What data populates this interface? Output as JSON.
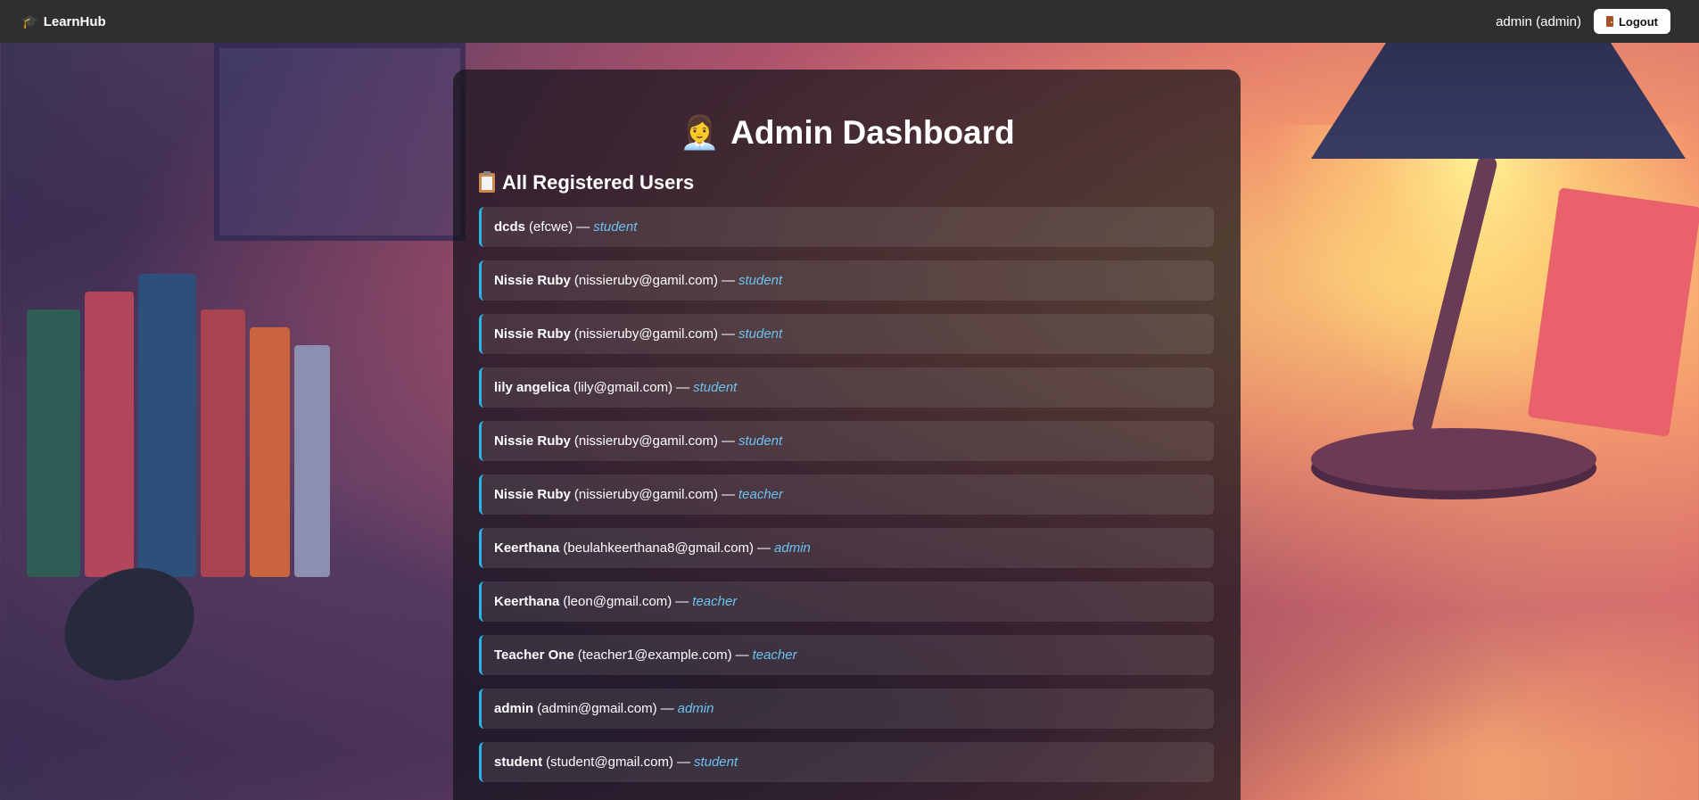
{
  "navbar": {
    "brand": "LearnHub",
    "brand_icon": "graduation-cap-icon",
    "user_label": "admin (admin)",
    "logout_label": "Logout",
    "logout_icon": "door-icon"
  },
  "main": {
    "title": "Admin Dashboard",
    "title_emoji": "👩‍💼",
    "section_title": "All Registered Users",
    "section_icon": "clipboard-icon",
    "separator": "—",
    "users": [
      {
        "name": "dcds",
        "email": "(efcwe)",
        "role": "student"
      },
      {
        "name": "Nissie Ruby",
        "email": "(nissieruby@gamil.com)",
        "role": "student"
      },
      {
        "name": "Nissie Ruby",
        "email": "(nissieruby@gamil.com)",
        "role": "student"
      },
      {
        "name": "lily angelica",
        "email": "(lily@gmail.com)",
        "role": "student"
      },
      {
        "name": "Nissie Ruby",
        "email": "(nissieruby@gamil.com)",
        "role": "student"
      },
      {
        "name": "Nissie Ruby",
        "email": "(nissieruby@gamil.com)",
        "role": "teacher"
      },
      {
        "name": "Keerthana",
        "email": "(beulahkeerthana8@gmail.com)",
        "role": "admin"
      },
      {
        "name": "Keerthana",
        "email": "(leon@gmail.com)",
        "role": "teacher"
      },
      {
        "name": "Teacher One",
        "email": "(teacher1@example.com)",
        "role": "teacher"
      },
      {
        "name": "admin",
        "email": "(admin@gmail.com)",
        "role": "admin"
      },
      {
        "name": "student",
        "email": "(student@gmail.com)",
        "role": "student"
      }
    ]
  },
  "colors": {
    "navbar_bg": "#2f2f2f",
    "accent": "#29b3e6",
    "role_text": "#6cc3f0"
  }
}
